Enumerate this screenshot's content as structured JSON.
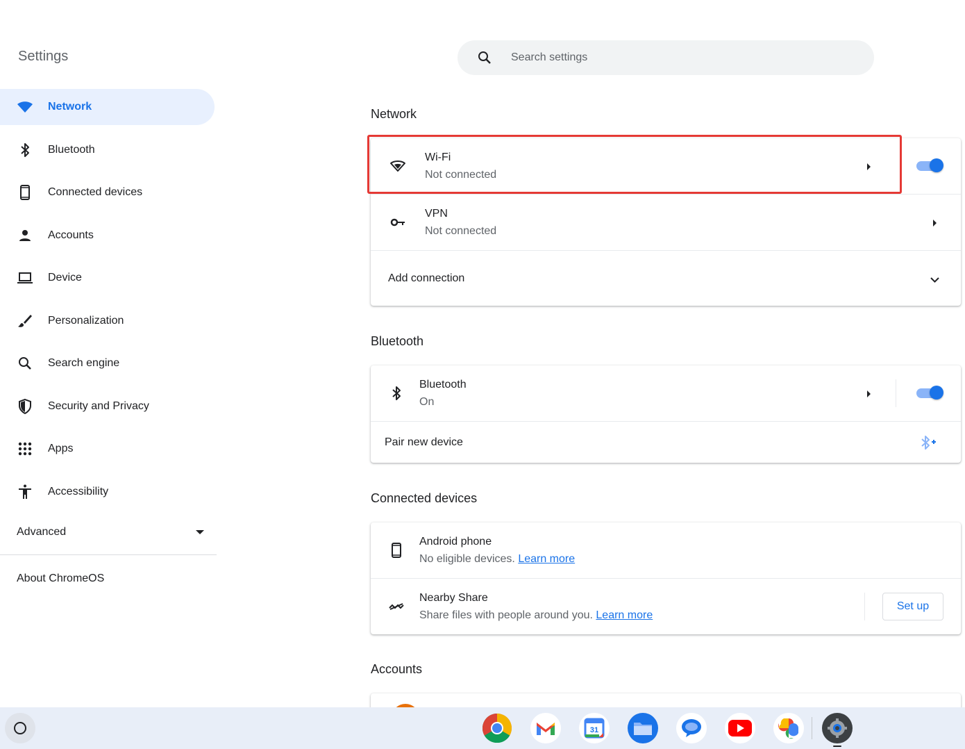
{
  "app": {
    "title": "Settings"
  },
  "search": {
    "placeholder": "Search settings",
    "icon": "search-icon"
  },
  "sidebar": {
    "items": [
      {
        "label": "Network",
        "icon": "wifi-icon",
        "active": true
      },
      {
        "label": "Bluetooth",
        "icon": "bluetooth-icon"
      },
      {
        "label": "Connected devices",
        "icon": "phone-icon"
      },
      {
        "label": "Accounts",
        "icon": "person-icon"
      },
      {
        "label": "Device",
        "icon": "laptop-icon"
      },
      {
        "label": "Personalization",
        "icon": "brush-icon"
      },
      {
        "label": "Search engine",
        "icon": "search-icon"
      },
      {
        "label": "Security and Privacy",
        "icon": "shield-icon"
      },
      {
        "label": "Apps",
        "icon": "apps-grid-icon"
      },
      {
        "label": "Accessibility",
        "icon": "accessibility-icon"
      }
    ],
    "advanced": "Advanced",
    "about": "About ChromeOS"
  },
  "network": {
    "title": "Network",
    "wifi": {
      "label": "Wi-Fi",
      "status": "Not connected",
      "enabled": true
    },
    "vpn": {
      "label": "VPN",
      "status": "Not connected"
    },
    "add_connection": "Add connection"
  },
  "bluetooth": {
    "title": "Bluetooth",
    "row": {
      "label": "Bluetooth",
      "status": "On",
      "enabled": true
    },
    "pair": "Pair new device"
  },
  "connected_devices": {
    "title": "Connected devices",
    "android": {
      "label": "Android phone",
      "status": "No eligible devices.",
      "link": "Learn more"
    },
    "nearby": {
      "label": "Nearby Share",
      "status": "Share files with people around you.",
      "link": "Learn more",
      "button": "Set up"
    }
  },
  "accounts": {
    "title": "Accounts"
  },
  "shelf": {
    "apps": [
      "chrome-icon",
      "gmail-icon",
      "calendar-icon",
      "files-icon",
      "messages-icon",
      "youtube-icon",
      "photos-icon",
      "settings-icon"
    ],
    "calendar_day": "31"
  },
  "colors": {
    "accent": "#1a73e8",
    "active_bg": "#e8f0fe",
    "highlight": "#e53935"
  }
}
